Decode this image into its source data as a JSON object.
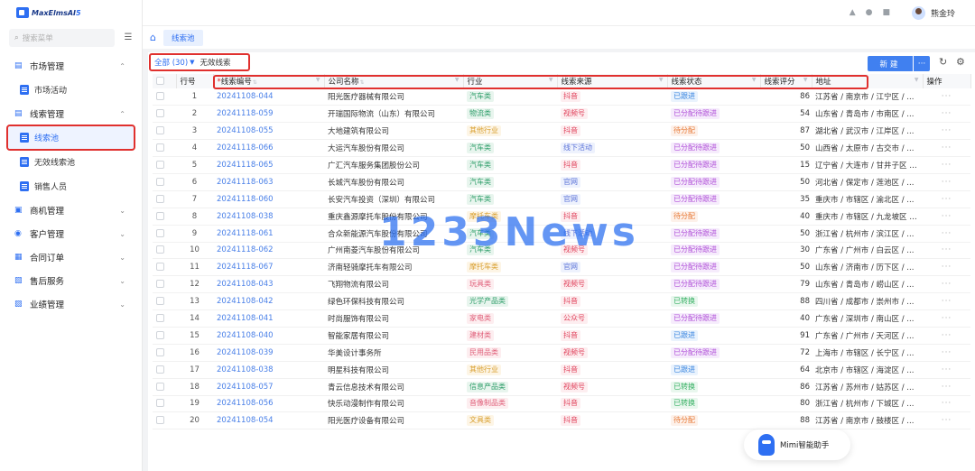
{
  "app": {
    "logo_text": "MaxElmsAI",
    "logo_suffix": "5"
  },
  "sidebar": {
    "search_placeholder": "搜索菜单",
    "groups": [
      {
        "label": "市场管理",
        "expanded": true
      },
      {
        "label": "线索管理",
        "expanded": true
      },
      {
        "label": "商机管理",
        "expanded": false
      },
      {
        "label": "客户管理",
        "expanded": false
      },
      {
        "label": "合同订单",
        "expanded": false
      },
      {
        "label": "售后服务",
        "expanded": false
      },
      {
        "label": "业绩管理",
        "expanded": false
      }
    ],
    "items": {
      "market_activity": "市场活动",
      "lead_pool": "线索池",
      "invalid_pool": "无效线索池",
      "sales_staff": "销售人员"
    }
  },
  "header": {
    "user_name": "熊金玲"
  },
  "tabs": {
    "active": "线索池"
  },
  "toolbar": {
    "view_all": "全部 (30)",
    "view_invalid": "无效线索",
    "new_label": "新建",
    "more_label": "···"
  },
  "table": {
    "headers": {
      "row_no": "行号",
      "lead_code": "线索编号",
      "company": "公司名称",
      "industry": "行业",
      "source": "线索来源",
      "status": "线索状态",
      "score": "线索评分",
      "address": "地址",
      "actions": "操作"
    },
    "rows": [
      {
        "no": "1",
        "code": "20241108-044",
        "company": "阳光医疗器械有限公司",
        "industry": "汽车类",
        "source": "抖音",
        "status": "已跟进",
        "score": "86",
        "address": "江苏省 / 南京市 / 江宁区 / ..."
      },
      {
        "no": "2",
        "code": "20241118-059",
        "company": "开瑞国际物流（山东）有限公司",
        "industry": "物流类",
        "source": "视频号",
        "status": "已分配待跟进",
        "score": "54",
        "address": "山东省 / 青岛市 / 市南区 / ..."
      },
      {
        "no": "3",
        "code": "20241108-055",
        "company": "大地建筑有限公司",
        "industry": "其他行业",
        "source": "抖音",
        "status": "待分配",
        "score": "87",
        "address": "湖北省 / 武汉市 / 江岸区 / ..."
      },
      {
        "no": "4",
        "code": "20241118-066",
        "company": "大运汽车股份有限公司",
        "industry": "汽车类",
        "source": "线下活动",
        "status": "已分配待跟进",
        "score": "50",
        "address": "山西省 / 太原市 / 古交市 / ..."
      },
      {
        "no": "5",
        "code": "20241118-065",
        "company": "广汇汽车服务集团股份公司",
        "industry": "汽车类",
        "source": "抖音",
        "status": "已分配待跟进",
        "score": "15",
        "address": "辽宁省 / 大连市 / 甘井子区 / ..."
      },
      {
        "no": "6",
        "code": "20241118-063",
        "company": "长城汽车股份有限公司",
        "industry": "汽车类",
        "source": "官网",
        "status": "已分配待跟进",
        "score": "50",
        "address": "河北省 / 保定市 / 莲池区 / ..."
      },
      {
        "no": "7",
        "code": "20241118-060",
        "company": "长安汽车投资（深圳）有限公司",
        "industry": "汽车类",
        "source": "官网",
        "status": "已分配待跟进",
        "score": "35",
        "address": "重庆市 / 市辖区 / 渝北区 / ..."
      },
      {
        "no": "8",
        "code": "20241108-038",
        "company": "重庆鑫源摩托车股份有限公司",
        "industry": "摩托车类",
        "source": "抖音",
        "status": "待分配",
        "score": "40",
        "address": "重庆市 / 市辖区 / 九龙坡区 / ..."
      },
      {
        "no": "9",
        "code": "20241118-061",
        "company": "合众新能源汽车股份有限公司",
        "industry": "汽车类",
        "source": "线下活动",
        "status": "已分配待跟进",
        "score": "50",
        "address": "浙江省 / 杭州市 / 滨江区 / ..."
      },
      {
        "no": "10",
        "code": "20241118-062",
        "company": "广州南菱汽车股份有限公司",
        "industry": "汽车类",
        "source": "视频号",
        "status": "已分配待跟进",
        "score": "30",
        "address": "广东省 / 广州市 / 白云区 / ..."
      },
      {
        "no": "11",
        "code": "20241118-067",
        "company": "济南轻骑摩托车有限公司",
        "industry": "摩托车类",
        "source": "官网",
        "status": "已分配待跟进",
        "score": "50",
        "address": "山东省 / 济南市 / 历下区 / ..."
      },
      {
        "no": "12",
        "code": "20241108-043",
        "company": "飞翔物流有限公司",
        "industry": "玩具类",
        "source": "视频号",
        "status": "已分配待跟进",
        "score": "79",
        "address": "山东省 / 青岛市 / 崂山区 / ..."
      },
      {
        "no": "13",
        "code": "20241108-042",
        "company": "绿色环保科技有限公司",
        "industry": "光学产品类",
        "source": "抖音",
        "status": "已转换",
        "score": "88",
        "address": "四川省 / 成都市 / 崇州市 / ..."
      },
      {
        "no": "14",
        "code": "20241108-041",
        "company": "时尚服饰有限公司",
        "industry": "家电类",
        "source": "公众号",
        "status": "已分配待跟进",
        "score": "40",
        "address": "广东省 / 深圳市 / 南山区 / ..."
      },
      {
        "no": "15",
        "code": "20241108-040",
        "company": "智能家居有限公司",
        "industry": "建材类",
        "source": "抖音",
        "status": "已跟进",
        "score": "91",
        "address": "广东省 / 广州市 / 天河区 / ..."
      },
      {
        "no": "16",
        "code": "20241108-039",
        "company": "华美设计事务所",
        "industry": "民用品类",
        "source": "视频号",
        "status": "已分配待跟进",
        "score": "72",
        "address": "上海市 / 市辖区 / 长宁区 / ..."
      },
      {
        "no": "17",
        "code": "20241108-038",
        "company": "明星科技有限公司",
        "industry": "其他行业",
        "source": "抖音",
        "status": "已跟进",
        "score": "64",
        "address": "北京市 / 市辖区 / 海淀区 / ..."
      },
      {
        "no": "18",
        "code": "20241108-057",
        "company": "青云信息技术有限公司",
        "industry": "信息产品类",
        "source": "视频号",
        "status": "已转换",
        "score": "86",
        "address": "江苏省 / 苏州市 / 姑苏区 / ..."
      },
      {
        "no": "19",
        "code": "20241108-056",
        "company": "快乐动漫制作有限公司",
        "industry": "音像制品类",
        "source": "抖音",
        "status": "已转换",
        "score": "80",
        "address": "浙江省 / 杭州市 / 下城区 / ..."
      },
      {
        "no": "20",
        "code": "20241108-054",
        "company": "阳光医疗设备有限公司",
        "industry": "文具类",
        "source": "抖音",
        "status": "待分配",
        "score": "88",
        "address": "江苏省 / 南京市 / 鼓楼区 / ..."
      }
    ]
  },
  "tag_colors": {
    "industry_bg": "#e8f5ee",
    "industry_fg": "#2f9e6a",
    "industry_other_bg": "#fdf5e6",
    "industry_other_fg": "#d9a030",
    "industry_pink_bg": "#fdeef0",
    "industry_pink_fg": "#e0607a",
    "source_bg": "#fdeef0",
    "source_fg": "#e0405a",
    "source_alt_bg": "#eef2fd",
    "source_alt_fg": "#5a72d8",
    "status_followed_bg": "#eaf3fd",
    "status_followed_fg": "#3a86e0",
    "status_assigned_bg": "#f6ecfc",
    "status_assigned_fg": "#b050d8",
    "status_pending_bg": "#fdf1ea",
    "status_pending_fg": "#e87a38",
    "status_converted_bg": "#e9f7ee",
    "status_converted_fg": "#36b063"
  },
  "watermark": "1233News",
  "assistant": {
    "label": "Mimi智能助手"
  }
}
